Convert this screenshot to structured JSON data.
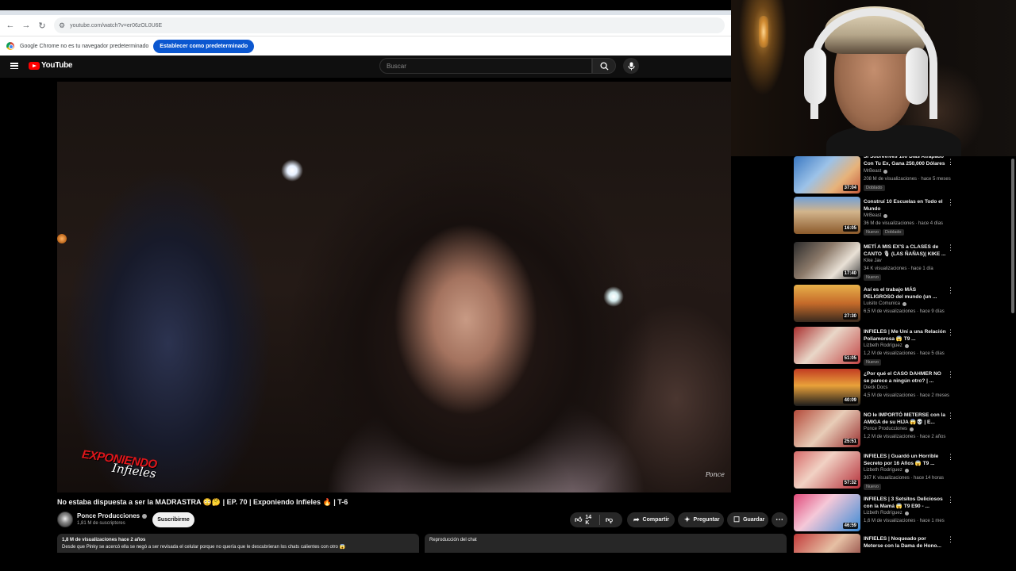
{
  "browser": {
    "url": "youtube.com/watch?v=er06zOL0U6E",
    "info_message": "Google Chrome no es tu navegador predeterminado",
    "set_default_label": "Establecer como predeterminado"
  },
  "masthead": {
    "logo_text": "YouTube",
    "search_placeholder": "Buscar"
  },
  "video": {
    "overlay_logo_line1": "EXPONIENDO",
    "overlay_logo_line2": "Infieles",
    "watermark": "Ponce",
    "title": "No estaba dispuesta a ser la MADRASTRA 😳🤔 | EP. 70 | Exponiendo Infieles 🔥 | T-6",
    "channel_name": "Ponce Producciones",
    "subscribers": "1,81 M de suscriptores",
    "subscribe_label": "Suscribirme",
    "likes": "14 K",
    "share_label": "Compartir",
    "ask_label": "Preguntar",
    "save_label": "Guardar",
    "description_meta": "1,8 M de visualizaciones  hace 2 años",
    "description_text": "Desde que Pinky se acercó ella se negó a ser revisada el celular porque no quería que le descubrieran los chats calientes con otro 😱",
    "chat_replay_label": "Reproducción del chat"
  },
  "sidebar": {
    "items": [
      {
        "title": "Si Sobrevives 100 Días Atrapado Con Tu Ex, Gana 250,000 Dólares",
        "channel": "MrBeast",
        "meta": "208 M de visualizaciones · hace 5 meses",
        "duration": "37:04",
        "badges": [
          "Doblado"
        ]
      },
      {
        "title": "Construí 10 Escuelas en Todo el Mundo",
        "channel": "MrBeast",
        "meta": "36 M de visualizaciones · hace 4 días",
        "duration": "16:05",
        "badges": [
          "Nuevo",
          "Doblado"
        ]
      },
      {
        "title": "METÍ A MIS EX'S a CLASES de CANTO 🎙 (LAS ÑAÑAS)| KIKE ...",
        "channel": "Kike Jav",
        "meta": "34 K visualizaciones · hace 1 día",
        "duration": "17:40",
        "badges": [
          "Nuevo"
        ]
      },
      {
        "title": "Así es el trabajo MÁS PELIGROSO del mundo (un ...",
        "channel": "Luisito Comunica",
        "meta": "6,5 M de visualizaciones · hace 9 días",
        "duration": "27:30",
        "badges": []
      },
      {
        "title": "INFIELES | Me Uní a una Relación Poliamorosa 😱 T9 ...",
        "channel": "Lizbeth Rodríguez",
        "meta": "1,2 M de visualizaciones · hace 5 días",
        "duration": "51:05",
        "badges": [
          "Nuevo"
        ]
      },
      {
        "title": "¿Por qué el CASO DAHMER NO se parece a ningún otro? | ...",
        "channel": "Dieck Docs",
        "meta": "4,5 M de visualizaciones · hace 2 meses",
        "duration": "40:09",
        "badges": []
      },
      {
        "title": "NO le IMPORTÓ METERSE con la AMIGA de su HIJA 😱💀 | E...",
        "channel": "Ponce Producciones",
        "meta": "1,2 M de visualizaciones · hace 2 años",
        "duration": "25:51",
        "badges": []
      },
      {
        "title": "INFIELES | Guardó un Horrible Secreto por 16 Años 😱 T9 ...",
        "channel": "Lizbeth Rodríguez",
        "meta": "367 K visualizaciones · hace 14 horas",
        "duration": "57:32",
        "badges": [
          "Nuevo"
        ]
      },
      {
        "title": "INFIELES | 3 Setsitos Deliciosos con la Mamá 😱 T9 E90 - ...",
        "channel": "Lizbeth Rodríguez",
        "meta": "1,6 M de visualizaciones · hace 1 mes",
        "duration": "46:59",
        "badges": []
      },
      {
        "title": "INFIELES | Noqueado por Meterse con la Dama de Hono...",
        "channel": "Lizbeth Rodríguez",
        "meta": "",
        "duration": "",
        "badges": []
      }
    ]
  },
  "colors": {
    "background": "#0f0f0f",
    "accent_red": "#ff0000",
    "chrome_blue": "#0b57d0"
  }
}
